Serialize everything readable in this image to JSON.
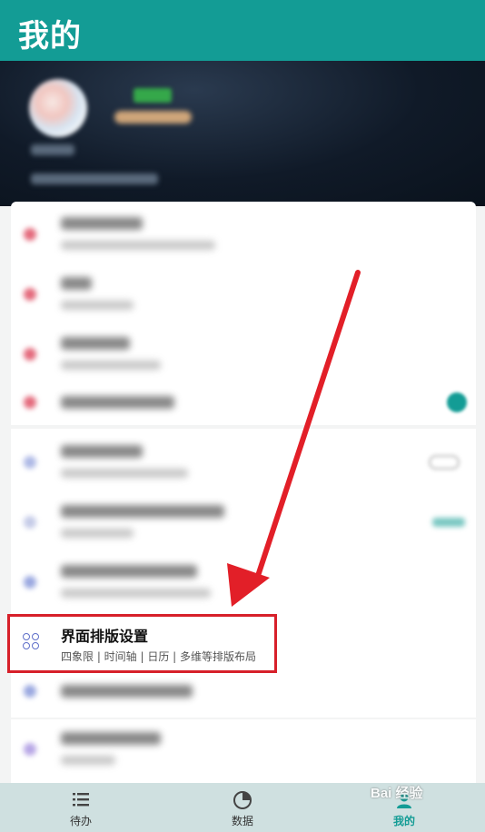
{
  "header": {
    "title": "我的"
  },
  "highlighted_item": {
    "label": "界面排版设置",
    "subtitle": "四象限 | 时间轴 | 日历 | 多维等排版布局"
  },
  "tabs": [
    {
      "label": "待办",
      "icon": "list-icon",
      "active": false
    },
    {
      "label": "数据",
      "icon": "pie-chart-icon",
      "active": false
    },
    {
      "label": "我的",
      "icon": "profile-icon",
      "active": true
    }
  ],
  "watermark": "Bai 经验",
  "colors": {
    "accent": "#139c95",
    "highlight_border": "#d7202a",
    "arrow": "#e21f28"
  }
}
